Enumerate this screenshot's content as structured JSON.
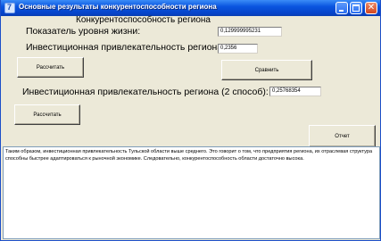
{
  "window": {
    "title": "Основные результаты конкурентоспособности региона",
    "icon": "delphi-app-icon"
  },
  "form": {
    "heading": "Конкурентоспособность региона",
    "living_standard_label": "Показатель уровня жизни:",
    "living_standard_value": "0,129999995231",
    "investment_label": "Инвестиционная привлекательность региона:",
    "investment_value": "0,2356",
    "calc_button_1": "Рассчитать",
    "compare_button": "Сравнить",
    "investment2_label": "Инвестиционная привлекательность региона (2 способ):",
    "investment2_value": "0,25768354",
    "calc_button_2": "Рассчитать",
    "report_button": "Отчет"
  },
  "memo": {
    "text": "Таким образом, инвестиционная привлекательность Тульской области выше среднего. Это говорит о том, что предприятия региона, их отраслевая структура способны быстрее адаптироваться к рыночной экономике. Следовательно, конкурентоспособность области достаточно высока."
  }
}
